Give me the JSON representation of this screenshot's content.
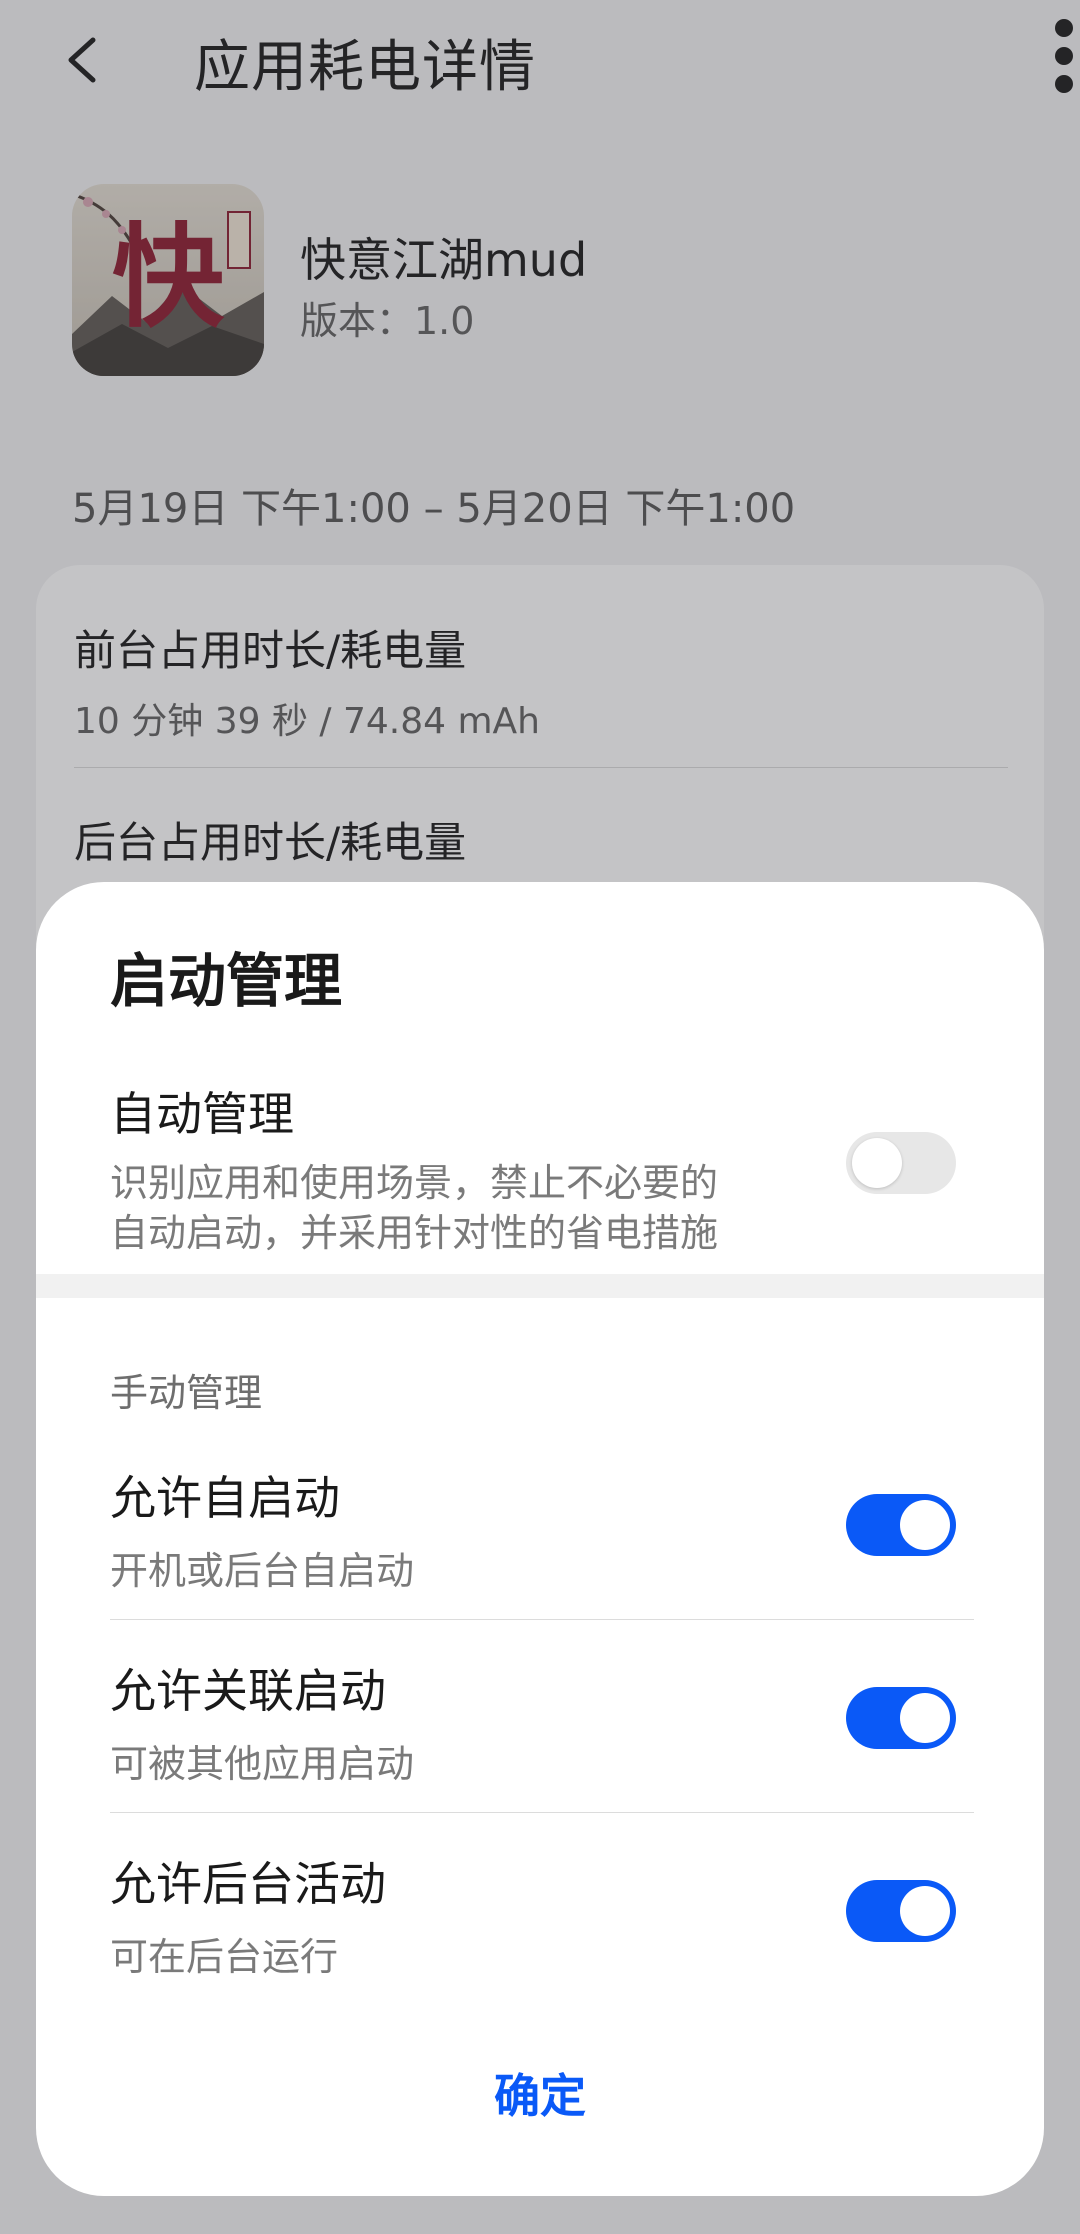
{
  "header": {
    "title": "应用耗电详情"
  },
  "app": {
    "name": "快意江湖mud",
    "version": "版本：1.0",
    "icon": {
      "glyph": "快",
      "seal": "快意江湖"
    }
  },
  "date_range": "5月19日 下午1:00 – 5月20日 下午1:00",
  "stats": [
    {
      "label": "前台占用时长/耗电量",
      "value": "10 分钟 39 秒 / 74.84 mAh"
    },
    {
      "label": "后台占用时长/耗电量"
    }
  ],
  "sheet": {
    "title": "启动管理",
    "auto": {
      "title": "自动管理",
      "desc_line1": "识别应用和使用场景，禁止不必要的",
      "desc_line2": "自动启动，并采用针对性的省电措施",
      "enabled": false
    },
    "manual_label": "手动管理",
    "toggles": [
      {
        "title": "允许自启动",
        "desc": "开机或后台自启动",
        "enabled": true
      },
      {
        "title": "允许关联启动",
        "desc": "可被其他应用启动",
        "enabled": true
      },
      {
        "title": "允许后台活动",
        "desc": "可在后台运行",
        "enabled": true
      }
    ],
    "confirm_label": "确定"
  },
  "colors": {
    "accent": "#0a59f7",
    "switch_off": "#e7e7e7"
  },
  "icons": {
    "back": "back-arrow-icon"
  }
}
